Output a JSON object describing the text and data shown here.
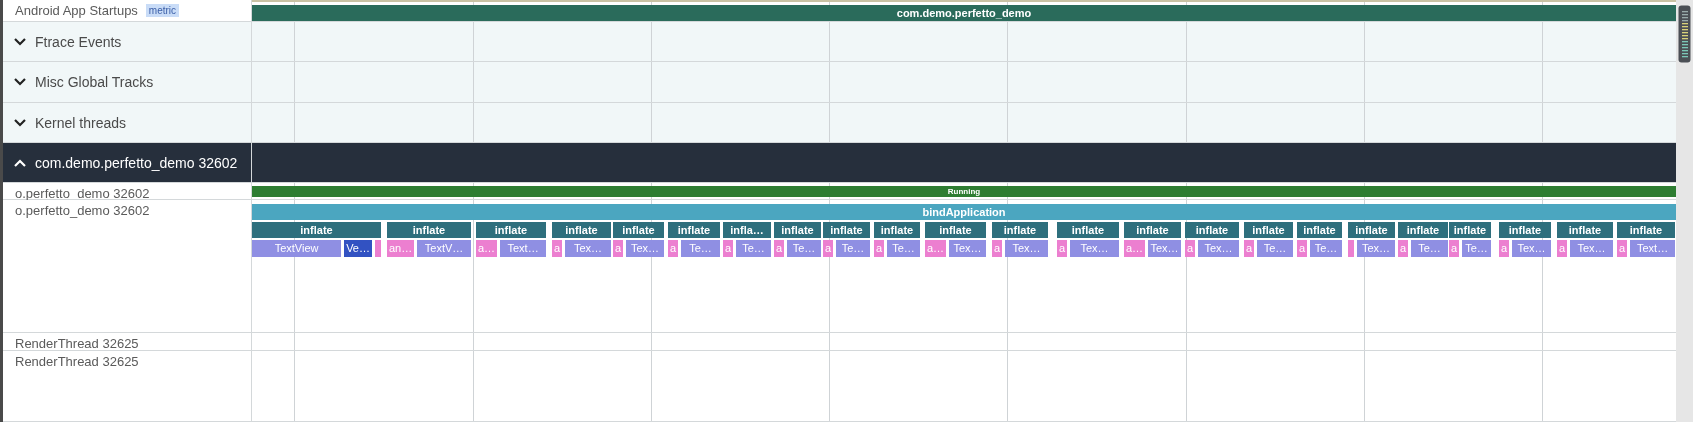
{
  "tracks": [
    {
      "kind": "summary",
      "title": "Android App Startups",
      "tag": "metric",
      "slices": [
        {
          "label": "com.demo.perfetto_demo",
          "color": "#2a6b5b"
        }
      ]
    },
    {
      "kind": "group",
      "title": "Ftrace Events",
      "expanded": false
    },
    {
      "kind": "group",
      "title": "Misc Global Tracks",
      "expanded": false
    },
    {
      "kind": "group",
      "title": "Kernel threads",
      "expanded": false
    },
    {
      "kind": "group",
      "title": "com.demo.perfetto_demo 32602",
      "expanded": true
    },
    {
      "kind": "state",
      "title": "o.perfetto_demo 32602",
      "slices": [
        {
          "label": "Running",
          "color": "#2e7d32"
        }
      ]
    },
    {
      "kind": "slices",
      "title": "o.perfetto_demo 32602",
      "slices": [
        {
          "label": "bindApplication",
          "color": "#4ba6c0",
          "children": [
            {
              "label": "inflate",
              "children": [
                {
                  "label": "TextView",
                  "color": "#8f8fe3"
                },
                {
                  "label": "Ve…",
                  "color": "#3252c2"
                },
                {
                  "color": "#ec7fd0"
                }
              ]
            },
            {
              "label": "inflate",
              "children": [
                {
                  "label": "an…",
                  "color": "#ec7fd0"
                },
                {
                  "label": "TextV…",
                  "color": "#8f8fe3"
                }
              ]
            },
            {
              "label": "inflate",
              "children": [
                {
                  "label": "a…",
                  "color": "#ec7fd0"
                },
                {
                  "label": "Text…",
                  "color": "#8f8fe3"
                }
              ]
            },
            {
              "label": "inflate",
              "children": [
                {
                  "label": "a",
                  "color": "#ec7fd0"
                },
                {
                  "label": "Tex…",
                  "color": "#8f8fe3"
                }
              ]
            },
            {
              "label": "inflate",
              "children": [
                {
                  "label": "a",
                  "color": "#ec7fd0"
                },
                {
                  "label": "Tex…",
                  "color": "#8f8fe3"
                }
              ]
            },
            {
              "label": "inflate",
              "children": [
                {
                  "label": "a",
                  "color": "#ec7fd0"
                },
                {
                  "label": "Te…",
                  "color": "#8f8fe3"
                }
              ]
            },
            {
              "label": "infla…",
              "children": [
                {
                  "label": "a",
                  "color": "#ec7fd0"
                },
                {
                  "label": "Te…",
                  "color": "#8f8fe3"
                }
              ]
            },
            {
              "label": "inflate",
              "children": [
                {
                  "label": "a",
                  "color": "#ec7fd0"
                },
                {
                  "label": "Te…",
                  "color": "#8f8fe3"
                }
              ]
            },
            {
              "label": "inflate",
              "children": [
                {
                  "label": "a",
                  "color": "#ec7fd0"
                },
                {
                  "label": "Te…",
                  "color": "#8f8fe3"
                }
              ]
            },
            {
              "label": "inflate",
              "children": [
                {
                  "label": "a",
                  "color": "#ec7fd0"
                },
                {
                  "label": "Te…",
                  "color": "#8f8fe3"
                }
              ]
            },
            {
              "label": "inflate",
              "children": [
                {
                  "label": "a…",
                  "color": "#ec7fd0"
                },
                {
                  "label": "Tex…",
                  "color": "#8f8fe3"
                }
              ]
            },
            {
              "label": "inflate",
              "children": [
                {
                  "label": "a",
                  "color": "#ec7fd0"
                },
                {
                  "label": "Tex…",
                  "color": "#8f8fe3"
                }
              ]
            },
            {
              "label": "inflate",
              "children": [
                {
                  "label": "a",
                  "color": "#ec7fd0"
                },
                {
                  "label": "Tex…",
                  "color": "#8f8fe3"
                }
              ]
            },
            {
              "label": "inflate",
              "children": [
                {
                  "label": "a…",
                  "color": "#ec7fd0"
                },
                {
                  "label": "Tex…",
                  "color": "#8f8fe3"
                }
              ]
            },
            {
              "label": "inflate",
              "children": [
                {
                  "label": "a",
                  "color": "#ec7fd0"
                },
                {
                  "label": "Tex…",
                  "color": "#8f8fe3"
                }
              ]
            },
            {
              "label": "inflate",
              "children": [
                {
                  "label": "a",
                  "color": "#ec7fd0"
                },
                {
                  "label": "Te…",
                  "color": "#8f8fe3"
                }
              ]
            },
            {
              "label": "inflate",
              "children": [
                {
                  "label": "a",
                  "color": "#ec7fd0"
                },
                {
                  "label": "Te…",
                  "color": "#8f8fe3"
                }
              ]
            },
            {
              "label": "inflate",
              "children": [
                {
                  "color": "#ec7fd0"
                },
                {
                  "label": "Tex…",
                  "color": "#8f8fe3"
                }
              ]
            },
            {
              "label": "inflate",
              "children": [
                {
                  "label": "a",
                  "color": "#ec7fd0"
                },
                {
                  "label": "Te…",
                  "color": "#8f8fe3"
                }
              ]
            },
            {
              "label": "inflate",
              "children": [
                {
                  "label": "a",
                  "color": "#ec7fd0"
                },
                {
                  "label": "Te…",
                  "color": "#8f8fe3"
                }
              ]
            },
            {
              "label": "inflate",
              "children": [
                {
                  "label": "a",
                  "color": "#ec7fd0"
                },
                {
                  "label": "Tex…",
                  "color": "#8f8fe3"
                }
              ]
            },
            {
              "label": "inflate",
              "children": [
                {
                  "label": "a",
                  "color": "#ec7fd0"
                },
                {
                  "label": "Tex…",
                  "color": "#8f8fe3"
                }
              ]
            },
            {
              "label": "inflate",
              "children": [
                {
                  "label": "a",
                  "color": "#ec7fd0"
                },
                {
                  "label": "Text…",
                  "color": "#8f8fe3"
                }
              ]
            }
          ]
        }
      ]
    },
    {
      "kind": "state",
      "title": "RenderThread 32625"
    },
    {
      "kind": "slices",
      "title": "RenderThread 32625"
    }
  ]
}
